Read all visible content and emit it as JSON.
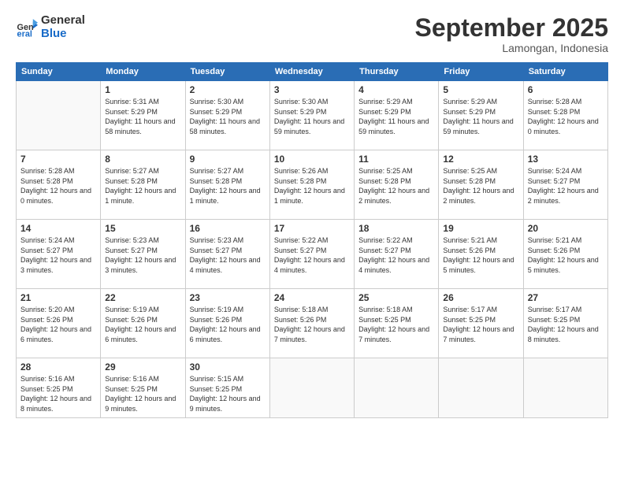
{
  "logo": {
    "general": "General",
    "blue": "Blue"
  },
  "title": "September 2025",
  "subtitle": "Lamongan, Indonesia",
  "headers": [
    "Sunday",
    "Monday",
    "Tuesday",
    "Wednesday",
    "Thursday",
    "Friday",
    "Saturday"
  ],
  "weeks": [
    [
      {
        "day": "",
        "detail": ""
      },
      {
        "day": "1",
        "detail": "Sunrise: 5:31 AM\nSunset: 5:29 PM\nDaylight: 11 hours\nand 58 minutes."
      },
      {
        "day": "2",
        "detail": "Sunrise: 5:30 AM\nSunset: 5:29 PM\nDaylight: 11 hours\nand 58 minutes."
      },
      {
        "day": "3",
        "detail": "Sunrise: 5:30 AM\nSunset: 5:29 PM\nDaylight: 11 hours\nand 59 minutes."
      },
      {
        "day": "4",
        "detail": "Sunrise: 5:29 AM\nSunset: 5:29 PM\nDaylight: 11 hours\nand 59 minutes."
      },
      {
        "day": "5",
        "detail": "Sunrise: 5:29 AM\nSunset: 5:29 PM\nDaylight: 11 hours\nand 59 minutes."
      },
      {
        "day": "6",
        "detail": "Sunrise: 5:28 AM\nSunset: 5:28 PM\nDaylight: 12 hours\nand 0 minutes."
      }
    ],
    [
      {
        "day": "7",
        "detail": "Sunrise: 5:28 AM\nSunset: 5:28 PM\nDaylight: 12 hours\nand 0 minutes."
      },
      {
        "day": "8",
        "detail": "Sunrise: 5:27 AM\nSunset: 5:28 PM\nDaylight: 12 hours\nand 1 minute."
      },
      {
        "day": "9",
        "detail": "Sunrise: 5:27 AM\nSunset: 5:28 PM\nDaylight: 12 hours\nand 1 minute."
      },
      {
        "day": "10",
        "detail": "Sunrise: 5:26 AM\nSunset: 5:28 PM\nDaylight: 12 hours\nand 1 minute."
      },
      {
        "day": "11",
        "detail": "Sunrise: 5:25 AM\nSunset: 5:28 PM\nDaylight: 12 hours\nand 2 minutes."
      },
      {
        "day": "12",
        "detail": "Sunrise: 5:25 AM\nSunset: 5:28 PM\nDaylight: 12 hours\nand 2 minutes."
      },
      {
        "day": "13",
        "detail": "Sunrise: 5:24 AM\nSunset: 5:27 PM\nDaylight: 12 hours\nand 2 minutes."
      }
    ],
    [
      {
        "day": "14",
        "detail": "Sunrise: 5:24 AM\nSunset: 5:27 PM\nDaylight: 12 hours\nand 3 minutes."
      },
      {
        "day": "15",
        "detail": "Sunrise: 5:23 AM\nSunset: 5:27 PM\nDaylight: 12 hours\nand 3 minutes."
      },
      {
        "day": "16",
        "detail": "Sunrise: 5:23 AM\nSunset: 5:27 PM\nDaylight: 12 hours\nand 4 minutes."
      },
      {
        "day": "17",
        "detail": "Sunrise: 5:22 AM\nSunset: 5:27 PM\nDaylight: 12 hours\nand 4 minutes."
      },
      {
        "day": "18",
        "detail": "Sunrise: 5:22 AM\nSunset: 5:27 PM\nDaylight: 12 hours\nand 4 minutes."
      },
      {
        "day": "19",
        "detail": "Sunrise: 5:21 AM\nSunset: 5:26 PM\nDaylight: 12 hours\nand 5 minutes."
      },
      {
        "day": "20",
        "detail": "Sunrise: 5:21 AM\nSunset: 5:26 PM\nDaylight: 12 hours\nand 5 minutes."
      }
    ],
    [
      {
        "day": "21",
        "detail": "Sunrise: 5:20 AM\nSunset: 5:26 PM\nDaylight: 12 hours\nand 6 minutes."
      },
      {
        "day": "22",
        "detail": "Sunrise: 5:19 AM\nSunset: 5:26 PM\nDaylight: 12 hours\nand 6 minutes."
      },
      {
        "day": "23",
        "detail": "Sunrise: 5:19 AM\nSunset: 5:26 PM\nDaylight: 12 hours\nand 6 minutes."
      },
      {
        "day": "24",
        "detail": "Sunrise: 5:18 AM\nSunset: 5:26 PM\nDaylight: 12 hours\nand 7 minutes."
      },
      {
        "day": "25",
        "detail": "Sunrise: 5:18 AM\nSunset: 5:25 PM\nDaylight: 12 hours\nand 7 minutes."
      },
      {
        "day": "26",
        "detail": "Sunrise: 5:17 AM\nSunset: 5:25 PM\nDaylight: 12 hours\nand 7 minutes."
      },
      {
        "day": "27",
        "detail": "Sunrise: 5:17 AM\nSunset: 5:25 PM\nDaylight: 12 hours\nand 8 minutes."
      }
    ],
    [
      {
        "day": "28",
        "detail": "Sunrise: 5:16 AM\nSunset: 5:25 PM\nDaylight: 12 hours\nand 8 minutes."
      },
      {
        "day": "29",
        "detail": "Sunrise: 5:16 AM\nSunset: 5:25 PM\nDaylight: 12 hours\nand 9 minutes."
      },
      {
        "day": "30",
        "detail": "Sunrise: 5:15 AM\nSunset: 5:25 PM\nDaylight: 12 hours\nand 9 minutes."
      },
      {
        "day": "",
        "detail": ""
      },
      {
        "day": "",
        "detail": ""
      },
      {
        "day": "",
        "detail": ""
      },
      {
        "day": "",
        "detail": ""
      }
    ]
  ]
}
